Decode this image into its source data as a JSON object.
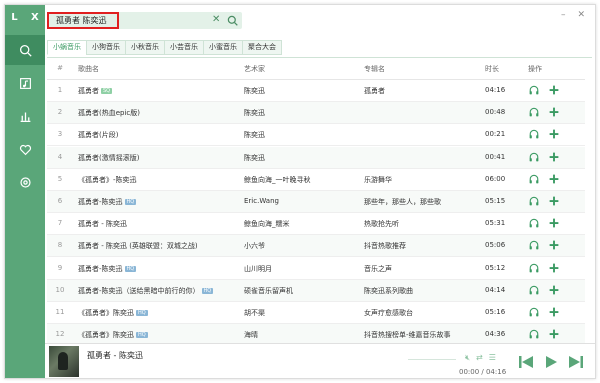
{
  "app": {
    "logo": "L X"
  },
  "sidebar": {
    "items": [
      {
        "icon": "search-icon"
      },
      {
        "icon": "music-library-icon"
      },
      {
        "icon": "chart-icon"
      },
      {
        "icon": "heart-icon"
      },
      {
        "icon": "settings-icon"
      }
    ]
  },
  "search": {
    "value": "孤勇者 陈奕迅"
  },
  "window": {
    "minimize": "–",
    "close": "✕"
  },
  "tabs": [
    "小蜗音乐",
    "小狗音乐",
    "小秋音乐",
    "小芸音乐",
    "小蜜音乐",
    "聚合大会"
  ],
  "list": {
    "headers": {
      "num": "#",
      "name": "歌曲名",
      "artist": "艺术家",
      "album": "专辑名",
      "time": "时长",
      "ops": "操作"
    },
    "rows": [
      {
        "num": "1",
        "name": "孤勇者",
        "badge": "SQ",
        "artist": "陈奕迅",
        "album": "孤勇者",
        "time": "04:16"
      },
      {
        "num": "2",
        "name": "孤勇者(热血epic版)",
        "badge": "",
        "artist": "陈奕迅",
        "album": "",
        "time": "00:48"
      },
      {
        "num": "3",
        "name": "孤勇者(片段)",
        "badge": "",
        "artist": "陈奕迅",
        "album": "",
        "time": "00:21"
      },
      {
        "num": "4",
        "name": "孤勇者(激情摇滚版)",
        "badge": "",
        "artist": "陈奕迅",
        "album": "",
        "time": "00:41"
      },
      {
        "num": "5",
        "name": "《孤勇者》-陈奕迅",
        "badge": "",
        "artist": "鲸鱼向海_一叶晚寻秋",
        "album": "乐游舞华",
        "time": "06:00"
      },
      {
        "num": "6",
        "name": "孤勇者-陈奕迅",
        "badge": "HQ",
        "artist": "Eric.Wang",
        "album": "那些年，那些人，那些歌",
        "time": "05:15"
      },
      {
        "num": "7",
        "name": "孤勇者 - 陈奕迅",
        "badge": "",
        "artist": "鲸鱼向海_糯米",
        "album": "热歌抢先听",
        "time": "05:31"
      },
      {
        "num": "8",
        "name": "孤勇者 - 陈奕迅 (英雄联盟：双城之战)",
        "badge": "",
        "artist": "小六爷",
        "album": "抖音热歌推荐",
        "time": "05:06"
      },
      {
        "num": "9",
        "name": "孤勇者-陈奕迅",
        "badge": "HQ",
        "artist": "山川明月",
        "album": "音乐之声",
        "time": "05:12"
      },
      {
        "num": "10",
        "name": "孤勇者-陈奕迅（送给黑暗中前行的你）",
        "badge": "HQ",
        "artist": "硕雀音乐留声机",
        "album": "陈奕迅系列歌曲",
        "time": "04:14"
      },
      {
        "num": "11",
        "name": "《孤勇者》陈奕迅",
        "badge": "HQ",
        "artist": "胡不渠",
        "album": "女声疗愈感歌台",
        "time": "05:16"
      },
      {
        "num": "12",
        "name": "《孤勇者》陈奕迅",
        "badge": "HQ",
        "artist": "海晴",
        "album": "抖音热搜榜单-维嘉音乐故事",
        "time": "04:36"
      }
    ]
  },
  "player": {
    "title": "孤勇者 - 陈奕迅",
    "time": "00:00 / 04:16",
    "progress": 0
  },
  "colors": {
    "accent": "#5aa679",
    "accent_dark": "#3f8c60",
    "op_icon": "#3a9a62"
  }
}
